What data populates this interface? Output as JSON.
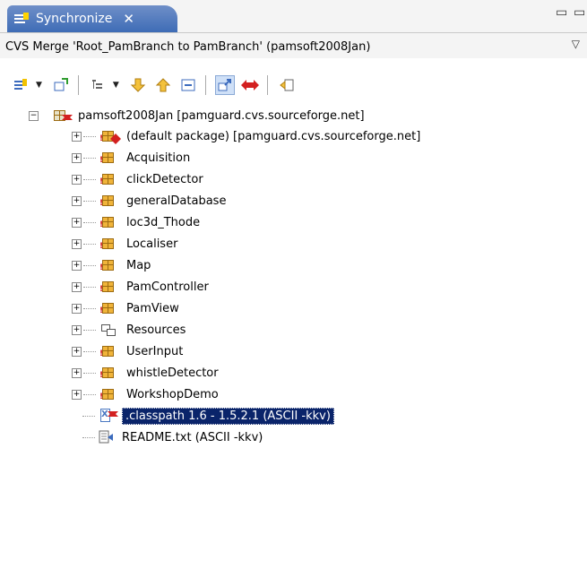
{
  "view": {
    "tab_title": "Synchronize",
    "tab_close_glyph": "✕",
    "minimize_glyph": "▭",
    "maximize_glyph": "▭",
    "description": "CVS Merge 'Root_PamBranch to PamBranch' (pamsoft2008Jan)",
    "menu_chevron": "▽"
  },
  "toolbar": {
    "icons": [
      "synchronize-icon",
      "dropdown-arrow",
      "pin-icon",
      "layout-icon",
      "dropdown-arrow",
      "next-down-arrow-icon",
      "previous-up-arrow-icon",
      "collapse-all-icon",
      "incoming-outgoing-mode-icon",
      "conflicts-mode-icon",
      "remove-icon"
    ]
  },
  "tree": {
    "root_label": "pamsoft2008Jan  [pamguard.cvs.sourceforge.net]",
    "items": [
      {
        "label": "(default package)  [pamguard.cvs.sourceforge.net]",
        "type": "conflict-package"
      },
      {
        "label": "Acquisition",
        "type": "package"
      },
      {
        "label": "clickDetector",
        "type": "package"
      },
      {
        "label": "generalDatabase",
        "type": "package"
      },
      {
        "label": "loc3d_Thode",
        "type": "package"
      },
      {
        "label": "Localiser",
        "type": "package"
      },
      {
        "label": "Map",
        "type": "package"
      },
      {
        "label": "PamController",
        "type": "package"
      },
      {
        "label": "PamView",
        "type": "package"
      },
      {
        "label": "Resources",
        "type": "folder"
      },
      {
        "label": "UserInput",
        "type": "package"
      },
      {
        "label": "whistleDetector",
        "type": "package"
      },
      {
        "label": "WorkshopDemo",
        "type": "package"
      }
    ],
    "files": [
      {
        "label": ".classpath  1.6 - 1.5.2.1  (ASCII -kkv)",
        "selected": true
      },
      {
        "label": "README.txt   (ASCII -kkv)",
        "selected": false
      }
    ],
    "expander_collapsed": "+",
    "expander_expanded": "−"
  },
  "colors": {
    "tab_active": "#3e6cb6",
    "selection": "#0a246a",
    "conflict_red": "#d32020",
    "package_yellow": "#f0b43a"
  }
}
